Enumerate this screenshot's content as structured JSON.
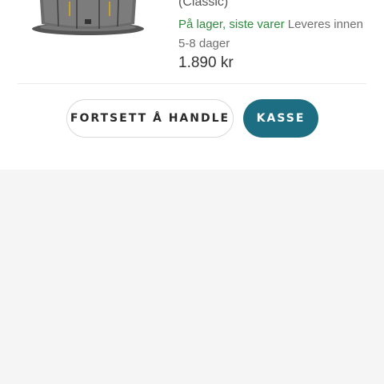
{
  "cart_item": {
    "image_icon": "trampoline-image",
    "variant": "(Classic)",
    "stock_status": "På lager, siste varer",
    "delivery": " Leveres innen 5-8 dager",
    "price": "1.890 kr"
  },
  "actions": {
    "continue_label": "FORTSETT Å HANDLE",
    "checkout_label": "KASSE"
  },
  "colors": {
    "accent": "#1d6e82",
    "in_stock": "#2f8a3d",
    "background": "#f5f5f5"
  }
}
